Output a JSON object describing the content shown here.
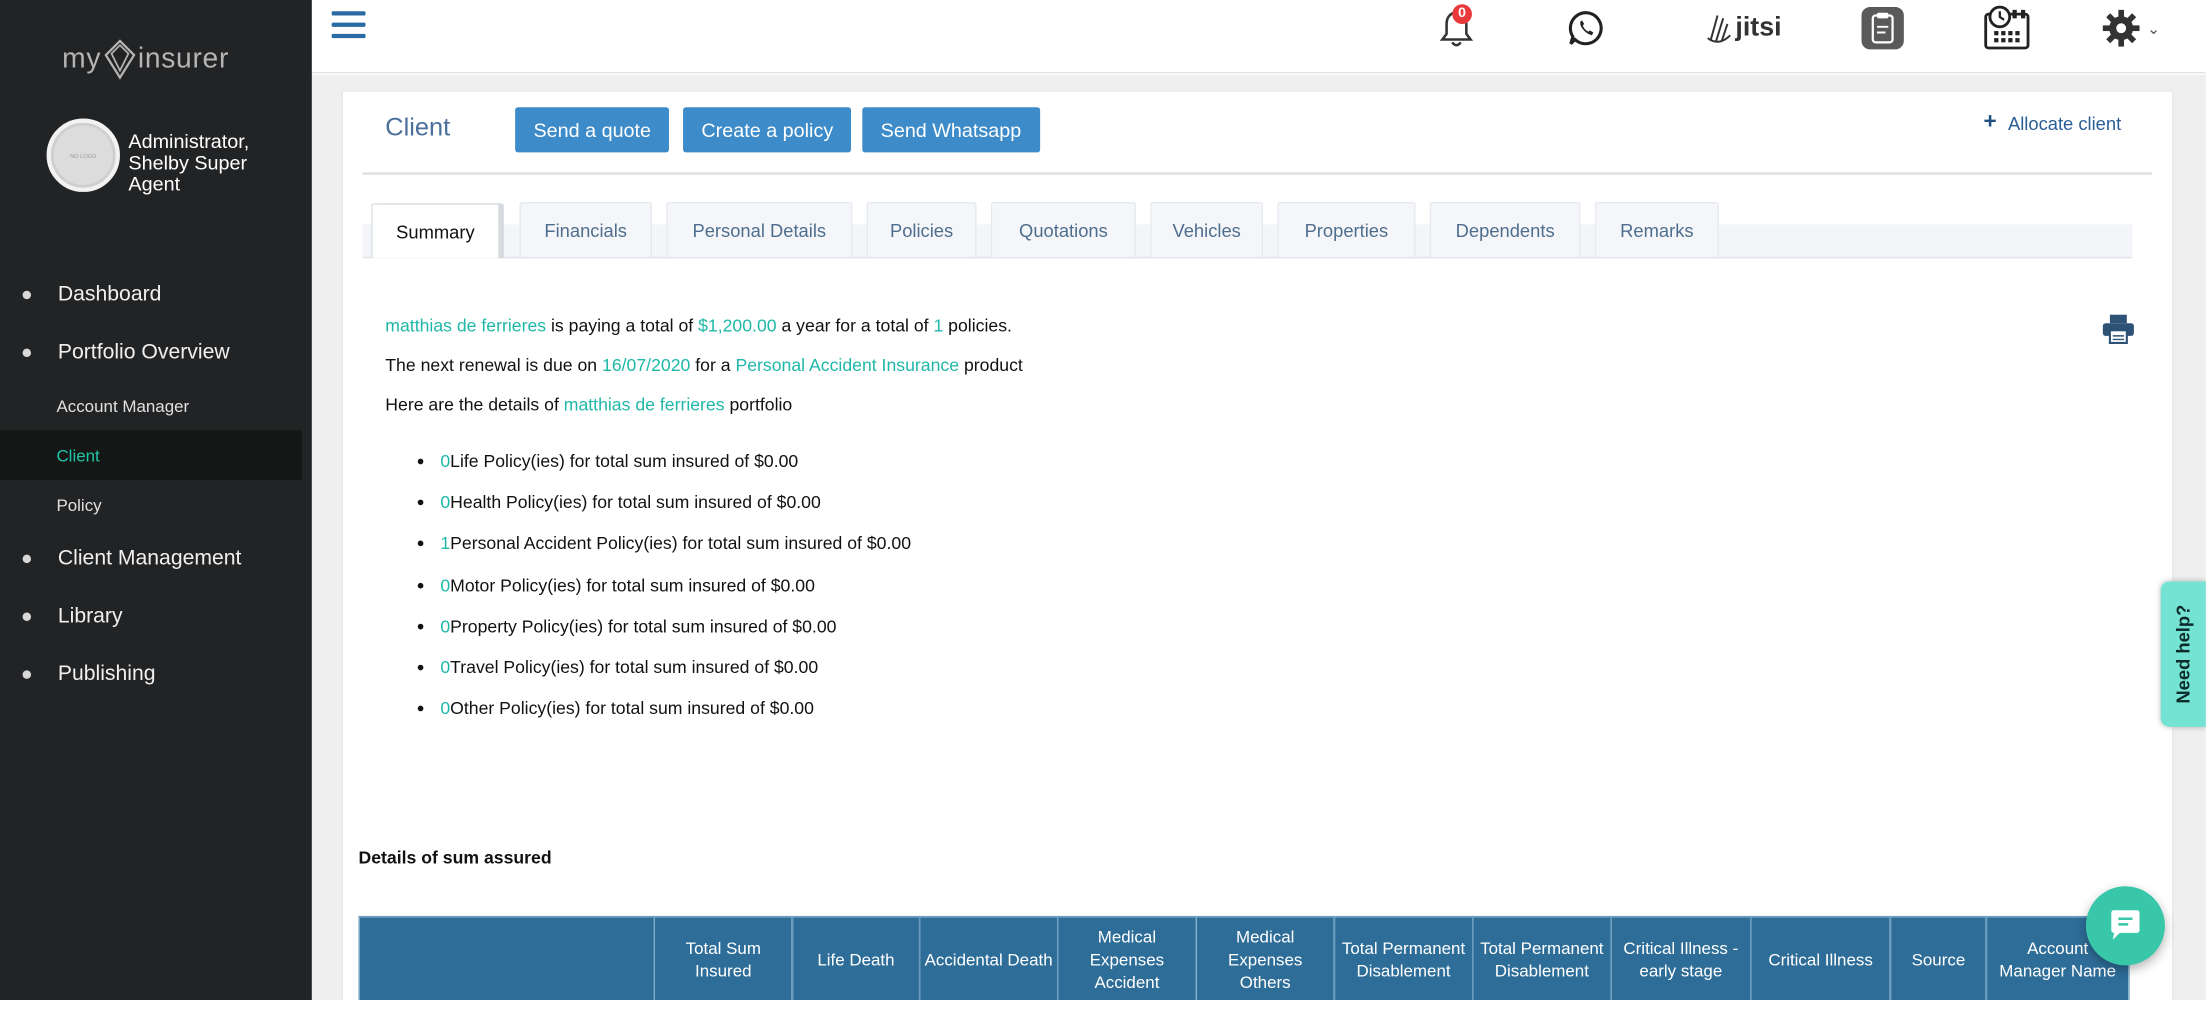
{
  "brand": {
    "prefix": "my",
    "suffix": "insurer"
  },
  "user": {
    "avatar_text": "NO LOGO",
    "name": "Administrator, Shelby Super Agent"
  },
  "sidebar": {
    "items": [
      {
        "label": "Dashboard"
      },
      {
        "label": "Portfolio Overview"
      },
      {
        "label": "Account Manager"
      },
      {
        "label": "Client"
      },
      {
        "label": "Policy"
      },
      {
        "label": "Client Management"
      },
      {
        "label": "Library"
      },
      {
        "label": "Publishing"
      }
    ],
    "active": "Client"
  },
  "topbar": {
    "notifications_count": "0",
    "jitsi_label": "jitsi",
    "icons": [
      "menu-icon",
      "bell-icon",
      "whatsapp-icon",
      "jitsi-icon",
      "clipboard-icon",
      "calendar-clock-icon",
      "gear-icon"
    ]
  },
  "header": {
    "title": "Client",
    "buttons": {
      "send_quote": "Send a quote",
      "create_policy": "Create a policy",
      "send_whatsapp": "Send Whatsapp"
    },
    "allocate": "Allocate client"
  },
  "tabs": [
    "Summary",
    "Financials",
    "Personal Details",
    "Policies",
    "Quotations",
    "Vehicles",
    "Properties",
    "Dependents",
    "Remarks"
  ],
  "active_tab": "Summary",
  "summary": {
    "client_name": "matthias de ferrieres",
    "paying_text": " is paying a total of ",
    "total_amount": "$1,200.00",
    "year_text": " a year for a total of ",
    "policy_count": "1",
    "policies_text": " policies.",
    "renewal_prefix": "The next renewal is due on ",
    "renewal_date": "16/07/2020",
    "renewal_mid": " for a ",
    "renewal_product": "Personal Accident Insurance",
    "renewal_suffix": " product",
    "details_prefix": "Here are the details of ",
    "details_suffix": " portfolio",
    "policies": [
      {
        "count": "0",
        "text": " Life Policy(ies) for total sum insured of $0.00"
      },
      {
        "count": "0",
        "text": " Health Policy(ies) for total sum insured of $0.00"
      },
      {
        "count": "1",
        "text": " Personal Accident Policy(ies) for total sum insured of $0.00"
      },
      {
        "count": "0",
        "text": " Motor Policy(ies) for total sum insured of $0.00"
      },
      {
        "count": "0",
        "text": " Property Policy(ies) for total sum insured of $0.00"
      },
      {
        "count": "0",
        "text": " Travel Policy(ies) for total sum insured of $0.00"
      },
      {
        "count": "0",
        "text": " Other Policy(ies) for total sum insured of $0.00"
      }
    ]
  },
  "sum_assured": {
    "title": "Details of sum assured",
    "columns": [
      "",
      "Total Sum Insured",
      "Life Death",
      "Accidental Death",
      "Medical Expenses Accident",
      "Medical Expenses Others",
      "Total Permanent Disablement",
      "Total Permanent Disablement",
      "Critical Illness - early stage",
      "Critical Illness",
      "Source",
      "Account Manager Name"
    ]
  },
  "help": {
    "label": "Need help?"
  },
  "colors": {
    "sidebar_bg": "#222325",
    "accent": "#1fb8a8",
    "button": "#3d8bc8",
    "table_header": "#2e6d98",
    "link": "#2a5f96"
  }
}
